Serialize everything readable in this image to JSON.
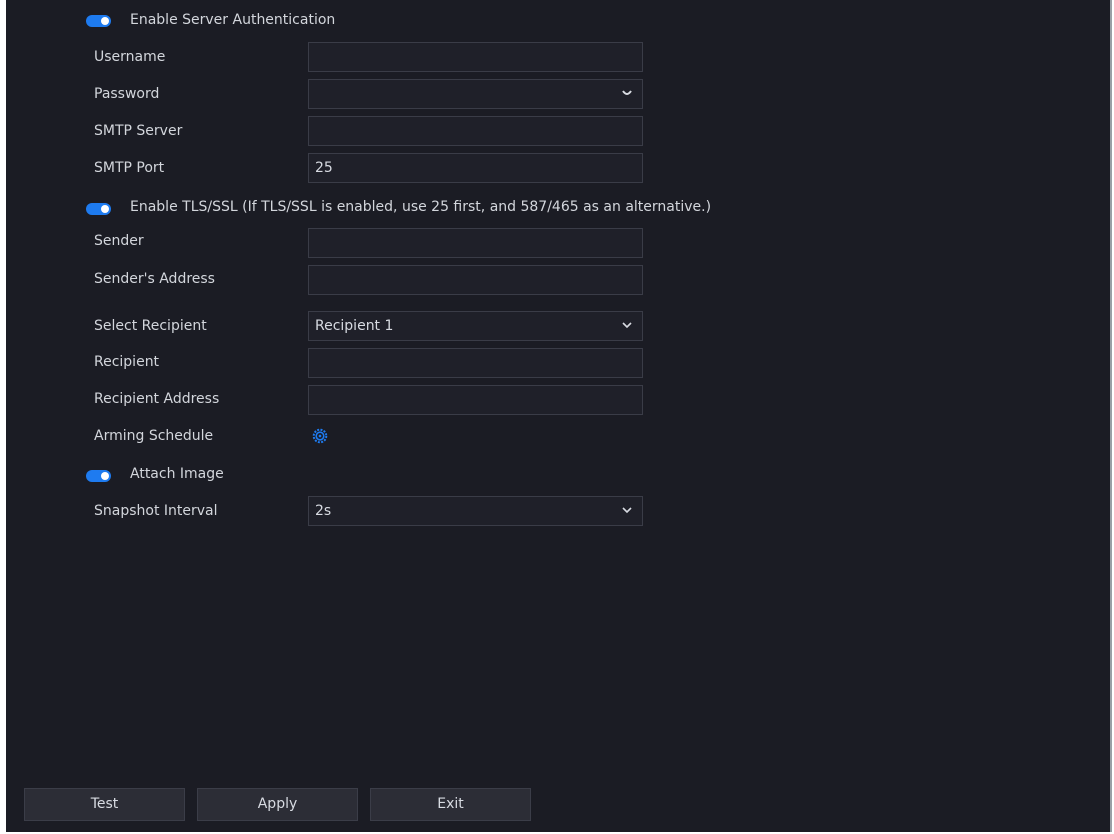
{
  "form": {
    "server_auth": {
      "label": "Enable Server Authentication",
      "enabled": true
    },
    "username": {
      "label": "Username",
      "value": ""
    },
    "password": {
      "label": "Password",
      "value": ""
    },
    "smtp_server": {
      "label": "SMTP Server",
      "value": ""
    },
    "smtp_port": {
      "label": "SMTP Port",
      "value": "25"
    },
    "tls": {
      "label": "Enable TLS/SSL (If TLS/SSL is enabled, use 25 first, and 587/465 as an alternative.)",
      "enabled": true
    },
    "sender": {
      "label": "Sender",
      "value": ""
    },
    "sender_address": {
      "label": "Sender's Address",
      "value": ""
    },
    "select_recipient": {
      "label": "Select Recipient",
      "value": "Recipient 1"
    },
    "recipient": {
      "label": "Recipient",
      "value": ""
    },
    "recipient_address": {
      "label": "Recipient Address",
      "value": ""
    },
    "arming_schedule": {
      "label": "Arming Schedule",
      "icon": "gear-icon"
    },
    "attach_image": {
      "label": "Attach Image",
      "enabled": true
    },
    "snapshot_interval": {
      "label": "Snapshot Interval",
      "value": "2s"
    }
  },
  "buttons": {
    "test": "Test",
    "apply": "Apply",
    "exit": "Exit"
  },
  "colors": {
    "background": "#1b1c24",
    "accent": "#1e7bf0",
    "field": "#1f2029"
  }
}
